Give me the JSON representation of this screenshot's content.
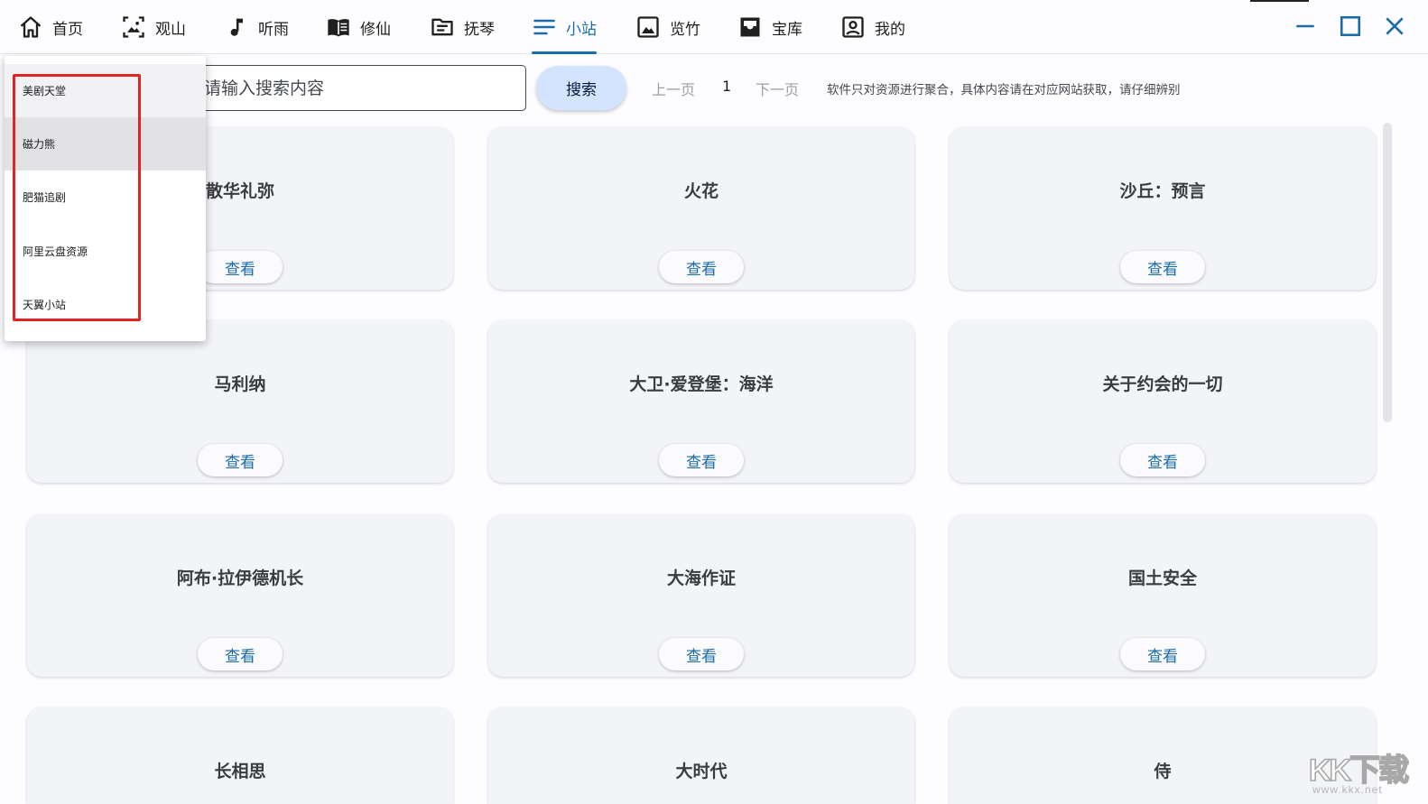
{
  "nav": {
    "items": [
      {
        "label": "首页",
        "icon": "home-icon"
      },
      {
        "label": "观山",
        "icon": "image-frame-icon"
      },
      {
        "label": "听雨",
        "icon": "music-note-icon"
      },
      {
        "label": "修仙",
        "icon": "book-icon"
      },
      {
        "label": "抚琴",
        "icon": "folder-icon"
      },
      {
        "label": "小站",
        "icon": "menu-lines-icon",
        "active": true
      },
      {
        "label": "览竹",
        "icon": "picture-icon"
      },
      {
        "label": "宝库",
        "icon": "inbox-icon"
      },
      {
        "label": "我的",
        "icon": "user-box-icon"
      }
    ],
    "active_color": "#1b6ca8"
  },
  "window_controls": {
    "minimize": "minimize-icon",
    "maximize": "maximize-icon",
    "close": "close-icon"
  },
  "search": {
    "placeholder": "请输入搜索内容",
    "value": "",
    "button_label": "搜索"
  },
  "pager": {
    "prev_label": "上一页",
    "page": "1",
    "next_label": "下一页"
  },
  "notice": "软件只对资源进行聚合，具体内容请在对应网站获取，请仔细辨别",
  "site_dropdown": {
    "options": [
      "美剧天堂",
      "磁力熊",
      "肥猫追剧",
      "阿里云盘资源",
      "天翼小站"
    ],
    "hovered": "磁力熊"
  },
  "cards": [
    {
      "title": "散华礼弥",
      "button": "查看"
    },
    {
      "title": "火花",
      "button": "查看"
    },
    {
      "title": "沙丘：预言",
      "button": "查看"
    },
    {
      "title": "马利纳",
      "button": "查看"
    },
    {
      "title": "大卫·爱登堡：海洋",
      "button": "查看"
    },
    {
      "title": "关于约会的一切",
      "button": "查看"
    },
    {
      "title": "阿布·拉伊德机长",
      "button": "查看"
    },
    {
      "title": "大海作证",
      "button": "查看"
    },
    {
      "title": "国土安全",
      "button": "查看"
    },
    {
      "title": "长相思",
      "button": "查看"
    },
    {
      "title": "大时代",
      "button": "查看"
    },
    {
      "title": "侍",
      "button": "查看"
    }
  ],
  "watermark": {
    "main": "KK下载",
    "sub": "www.kkx.net"
  }
}
